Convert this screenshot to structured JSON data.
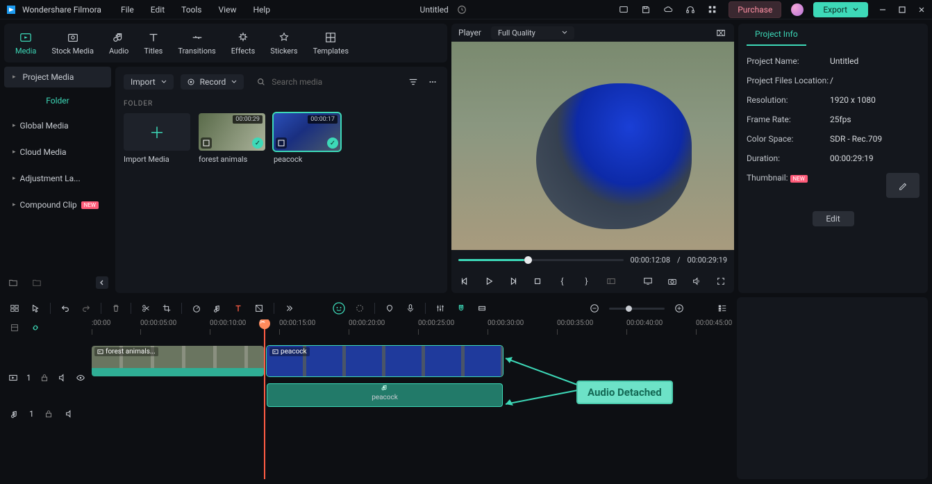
{
  "titlebar": {
    "app_name": "Wondershare Filmora",
    "menus": [
      "File",
      "Edit",
      "Tools",
      "View",
      "Help"
    ],
    "doc_title": "Untitled",
    "purchase": "Purchase",
    "export": "Export"
  },
  "tool_tabs": [
    {
      "id": "media",
      "label": "Media",
      "active": true
    },
    {
      "id": "stock",
      "label": "Stock Media"
    },
    {
      "id": "audio",
      "label": "Audio"
    },
    {
      "id": "titles",
      "label": "Titles"
    },
    {
      "id": "transitions",
      "label": "Transitions"
    },
    {
      "id": "effects",
      "label": "Effects"
    },
    {
      "id": "stickers",
      "label": "Stickers"
    },
    {
      "id": "templates",
      "label": "Templates"
    }
  ],
  "sidebar": {
    "project_media": "Project Media",
    "folder": "Folder",
    "items": [
      {
        "label": "Global Media"
      },
      {
        "label": "Cloud Media"
      },
      {
        "label": "Adjustment La..."
      },
      {
        "label": "Compound Clip",
        "badge": "NEW"
      }
    ]
  },
  "media_toolbar": {
    "import": "Import",
    "record": "Record",
    "search_placeholder": "Search media"
  },
  "folder_heading": "FOLDER",
  "media_items": [
    {
      "type": "import",
      "label": "Import Media"
    },
    {
      "type": "clip",
      "label": "forest animals",
      "duration": "00:00:29"
    },
    {
      "type": "clip",
      "label": "peacock",
      "duration": "00:00:17",
      "selected": true
    }
  ],
  "preview": {
    "tab": "Player",
    "quality": "Full Quality",
    "current": "00:00:12:08",
    "sep": "/",
    "total": "00:00:29:19",
    "progress_pct": 41
  },
  "props": {
    "tab": "Project Info",
    "rows": [
      {
        "k": "Project Name:",
        "v": "Untitled"
      },
      {
        "k": "Project Files Location:",
        "v": "/"
      },
      {
        "k": "Resolution:",
        "v": "1920 x 1080"
      },
      {
        "k": "Frame Rate:",
        "v": "25fps"
      },
      {
        "k": "Color Space:",
        "v": "SDR - Rec.709"
      },
      {
        "k": "Duration:",
        "v": "00:00:29:19"
      },
      {
        "k": "Thumbnail:",
        "v": "",
        "badge": "NEW"
      }
    ],
    "edit": "Edit"
  },
  "ruler": {
    "start": ":00:00",
    "marks": [
      "00:00:05:00",
      "00:00:10:00",
      "00:00:15:00",
      "00:00:20:00",
      "00:00:25:00",
      "00:00:30:00",
      "00:00:35:00",
      "00:00:40:00",
      "00:00:45:00"
    ]
  },
  "tracks": {
    "video": {
      "index": "1"
    },
    "audio": {
      "index": "1"
    }
  },
  "clips": {
    "video1": {
      "label": "forest animals..."
    },
    "video2": {
      "label": "peacock"
    },
    "audio2": {
      "label": "peacock"
    }
  },
  "annotation": "Audio Detached"
}
